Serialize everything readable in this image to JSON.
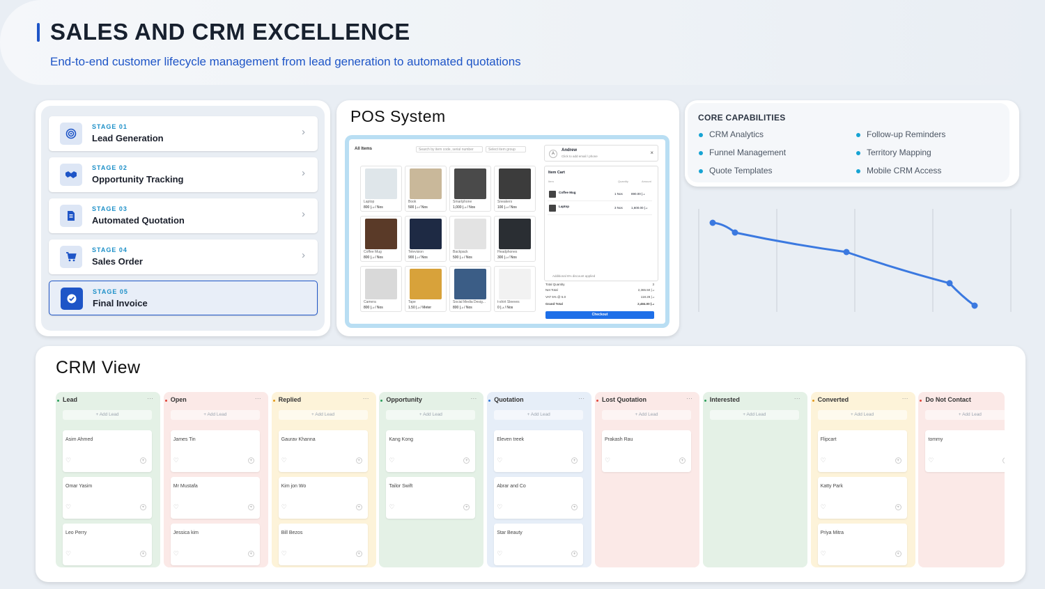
{
  "header": {
    "title": "SALES AND CRM EXCELLENCE",
    "subtitle": "End-to-end customer lifecycle management from lead generation to automated quotations"
  },
  "stages": [
    {
      "num": "STAGE 01",
      "name": "Lead Generation",
      "icon": "target-icon"
    },
    {
      "num": "STAGE 02",
      "name": "Opportunity Tracking",
      "icon": "handshake-icon"
    },
    {
      "num": "STAGE 03",
      "name": "Automated Quotation",
      "icon": "document-icon"
    },
    {
      "num": "STAGE 04",
      "name": "Sales Order",
      "icon": "cart-icon"
    },
    {
      "num": "STAGE 05",
      "name": "Final Invoice",
      "icon": "check-icon"
    }
  ],
  "pos": {
    "title": "POS System",
    "all_items": "All Items",
    "search_placeholder": "Search by item code, serial number",
    "group_placeholder": "Select item group",
    "products": [
      {
        "name": "Laptop",
        "price": "800 د.إ / Nos",
        "color": "#dfe6ea"
      },
      {
        "name": "Book",
        "price": "500 د.إ / Nos",
        "color": "#c9b89a"
      },
      {
        "name": "Smartphone",
        "price": "1,000 د.إ / Nos",
        "color": "#4a4a4a"
      },
      {
        "name": "Sneakers",
        "price": "100 د.إ / Nos",
        "color": "#3c3c3c"
      },
      {
        "name": "Coffee Mug",
        "price": "800 د.إ / Nos",
        "color": "#5a3a28"
      },
      {
        "name": "Television",
        "price": "900 د.إ / Nos",
        "color": "#1e2a44"
      },
      {
        "name": "Backpack",
        "price": "500 د.إ / Nos",
        "color": "#e3e3e3"
      },
      {
        "name": "Headphones",
        "price": "300 د.إ / Nos",
        "color": "#2a2e33"
      },
      {
        "name": "Camera",
        "price": "800 د.إ / Nos",
        "color": "#d9d9d9"
      },
      {
        "name": "Tape",
        "price": "1.50 د.إ / Meter",
        "color": "#d8a23a"
      },
      {
        "name": "Social Media Desig...",
        "price": "800 د.إ / Nos",
        "color": "#3b5d86"
      },
      {
        "name": "t-shirt Sleeves",
        "price": "0 د.إ / Nos",
        "color": "#f2f2f2"
      }
    ],
    "customer_name": "Andrew",
    "customer_hint": "Click to add email / phone",
    "cart_title": "Item Cart",
    "col_item": "Item",
    "col_qty": "Quantity",
    "col_amount": "Amount",
    "cart_items": [
      {
        "name": "Coffee Mug",
        "qty": "1 Nos",
        "amount": "890.00 د.إ"
      },
      {
        "name": "Laptop",
        "qty": "3 Nos",
        "amount": "1,600.00 د.إ"
      }
    ],
    "discount_note": "Additional 6% discount applied",
    "totals": [
      {
        "label": "Total Quantity",
        "value": "3"
      },
      {
        "label": "Net Total",
        "value": "2,365.50 د.إ"
      },
      {
        "label": "VAT 5% @ 5.0",
        "value": "118.28 د.إ"
      },
      {
        "label": "Grand Total",
        "value": "2,484.00 د.إ"
      }
    ],
    "checkout_label": "Checkout"
  },
  "capabilities": {
    "title": "CORE CAPABILITIES",
    "items": [
      "CRM Analytics",
      "Follow-up Reminders",
      "Funnel Management",
      "Territory Mapping",
      "Quote Templates",
      "Mobile CRM Access"
    ]
  },
  "curve": {
    "points": [
      [
        0,
        0.9
      ],
      [
        0.08,
        0.8
      ],
      [
        0.48,
        0.6
      ],
      [
        0.85,
        0.28
      ],
      [
        0.94,
        0.05
      ]
    ]
  },
  "crm": {
    "title": "CRM View",
    "add_lead_label": "+ Add Lead",
    "columns": [
      {
        "name": "Lead",
        "bg": "#e4f1e6",
        "dot": "#2a9d5b",
        "leads": [
          "Asim Ahmed",
          "Omar Yasim",
          "Leo Perry"
        ]
      },
      {
        "name": "Open",
        "bg": "#fbe9e7",
        "dot": "#e0453a",
        "leads": [
          "James Tin",
          "Mr Mustafa",
          "Jessica kim"
        ]
      },
      {
        "name": "Replied",
        "bg": "#fdf3d9",
        "dot": "#e39a1b",
        "leads": [
          "Gaurav Khanna",
          "Kim jon Wo",
          "Bill Bezos"
        ]
      },
      {
        "name": "Opportunity",
        "bg": "#e4f1e6",
        "dot": "#2a9d5b",
        "leads": [
          "Kang Kong",
          "Tailor Swift"
        ]
      },
      {
        "name": "Quotation",
        "bg": "#e6eef8",
        "dot": "#2f78d6",
        "leads": [
          "Eleven treek",
          "Abrar and Co",
          "Star Beauty"
        ]
      },
      {
        "name": "Lost Quotation",
        "bg": "#fbe9e7",
        "dot": "#e0453a",
        "leads": [
          "Prakash Rau"
        ]
      },
      {
        "name": "Interested",
        "bg": "#e4f1e6",
        "dot": "#2a9d5b",
        "leads": []
      },
      {
        "name": "Converted",
        "bg": "#fdf3d9",
        "dot": "#e39a1b",
        "leads": [
          "Flipcart",
          "Katty Park",
          "Priya Mitra"
        ]
      },
      {
        "name": "Do Not Contact",
        "bg": "#fbe9e7",
        "dot": "#e0453a",
        "leads": [
          "tommy"
        ]
      }
    ]
  }
}
